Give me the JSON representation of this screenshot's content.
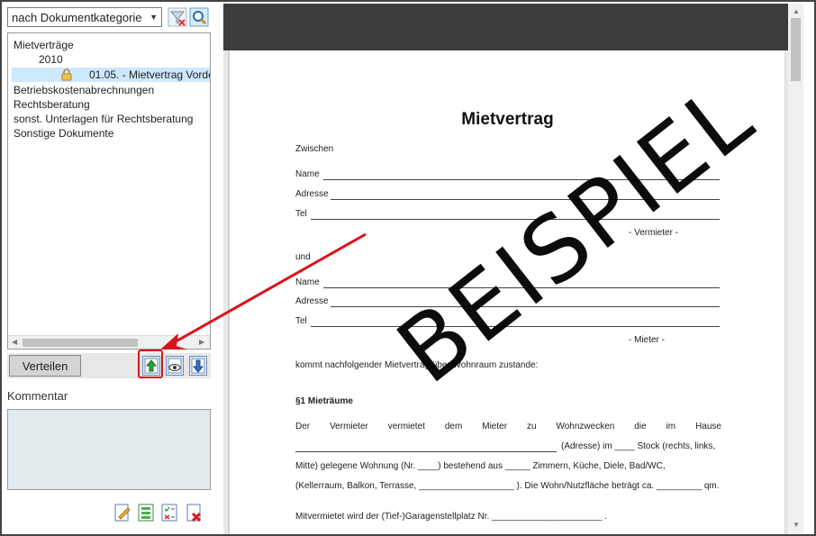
{
  "left_panel": {
    "category_select": {
      "value": "nach Dokumentkategorie"
    },
    "tree": {
      "items": [
        {
          "label": "Mietverträge"
        },
        {
          "label": "2010"
        },
        {
          "label": "01.05. - Mietvertrag Vorde"
        },
        {
          "label": "Betriebskostenabrechnungen"
        },
        {
          "label": "Rechtsberatung"
        },
        {
          "label": "sonst. Unterlagen für Rechtsberatung"
        },
        {
          "label": "Sonstige Dokumente"
        }
      ]
    },
    "verteilen_label": "Verteilen",
    "comment_label": "Kommentar",
    "icons": {
      "filter": "funnel-icon",
      "search": "magnifier-icon",
      "lock": "lock-icon",
      "upload": "upload-green-arrow-icon",
      "view": "eye-icon",
      "download": "download-arrow-icon",
      "edit": "edit-document-icon",
      "spreadsheet": "spreadsheet-icon",
      "checklist": "checklist-icon",
      "delete": "delete-document-icon"
    },
    "colors": {
      "highlight": "#d8131b",
      "selected": "#cde8ff"
    }
  },
  "document": {
    "title": "Mietvertrag",
    "zwischen": "Zwischen",
    "name_label": "Name",
    "adresse_label": "Adresse",
    "tel_label": "Tel",
    "vermieter_label": "- Vermieter -",
    "und": "und",
    "mieter_label": "- Mieter -",
    "kommt": "kommt nachfolgender Mietvertrag über Wohnraum zustande:",
    "section1": "§1  Mieträume",
    "para_line1_words": [
      "Der",
      "Vermieter",
      "vermietet",
      "dem",
      "Mieter",
      "zu",
      "Wohnzwecken",
      "die",
      "im",
      "Hause"
    ],
    "para_line2": "(Adresse) im ____ Stock (rechts, links,",
    "para_line3": "Mitte) gelegene Wohnung (Nr. ____) bestehend aus _____ Zimmern, Küche, Diele, Bad/WC,",
    "para_line4": "(Kellerraum, Balkon, Terrasse, ___________________ ). Die Wohn/Nutzfläche beträgt ca. _________ qm.",
    "garage": "Mitvermietet wird der (Tief-)Garagenstellplatz Nr. ______________________ .",
    "watermark": "BEISPIEL"
  }
}
